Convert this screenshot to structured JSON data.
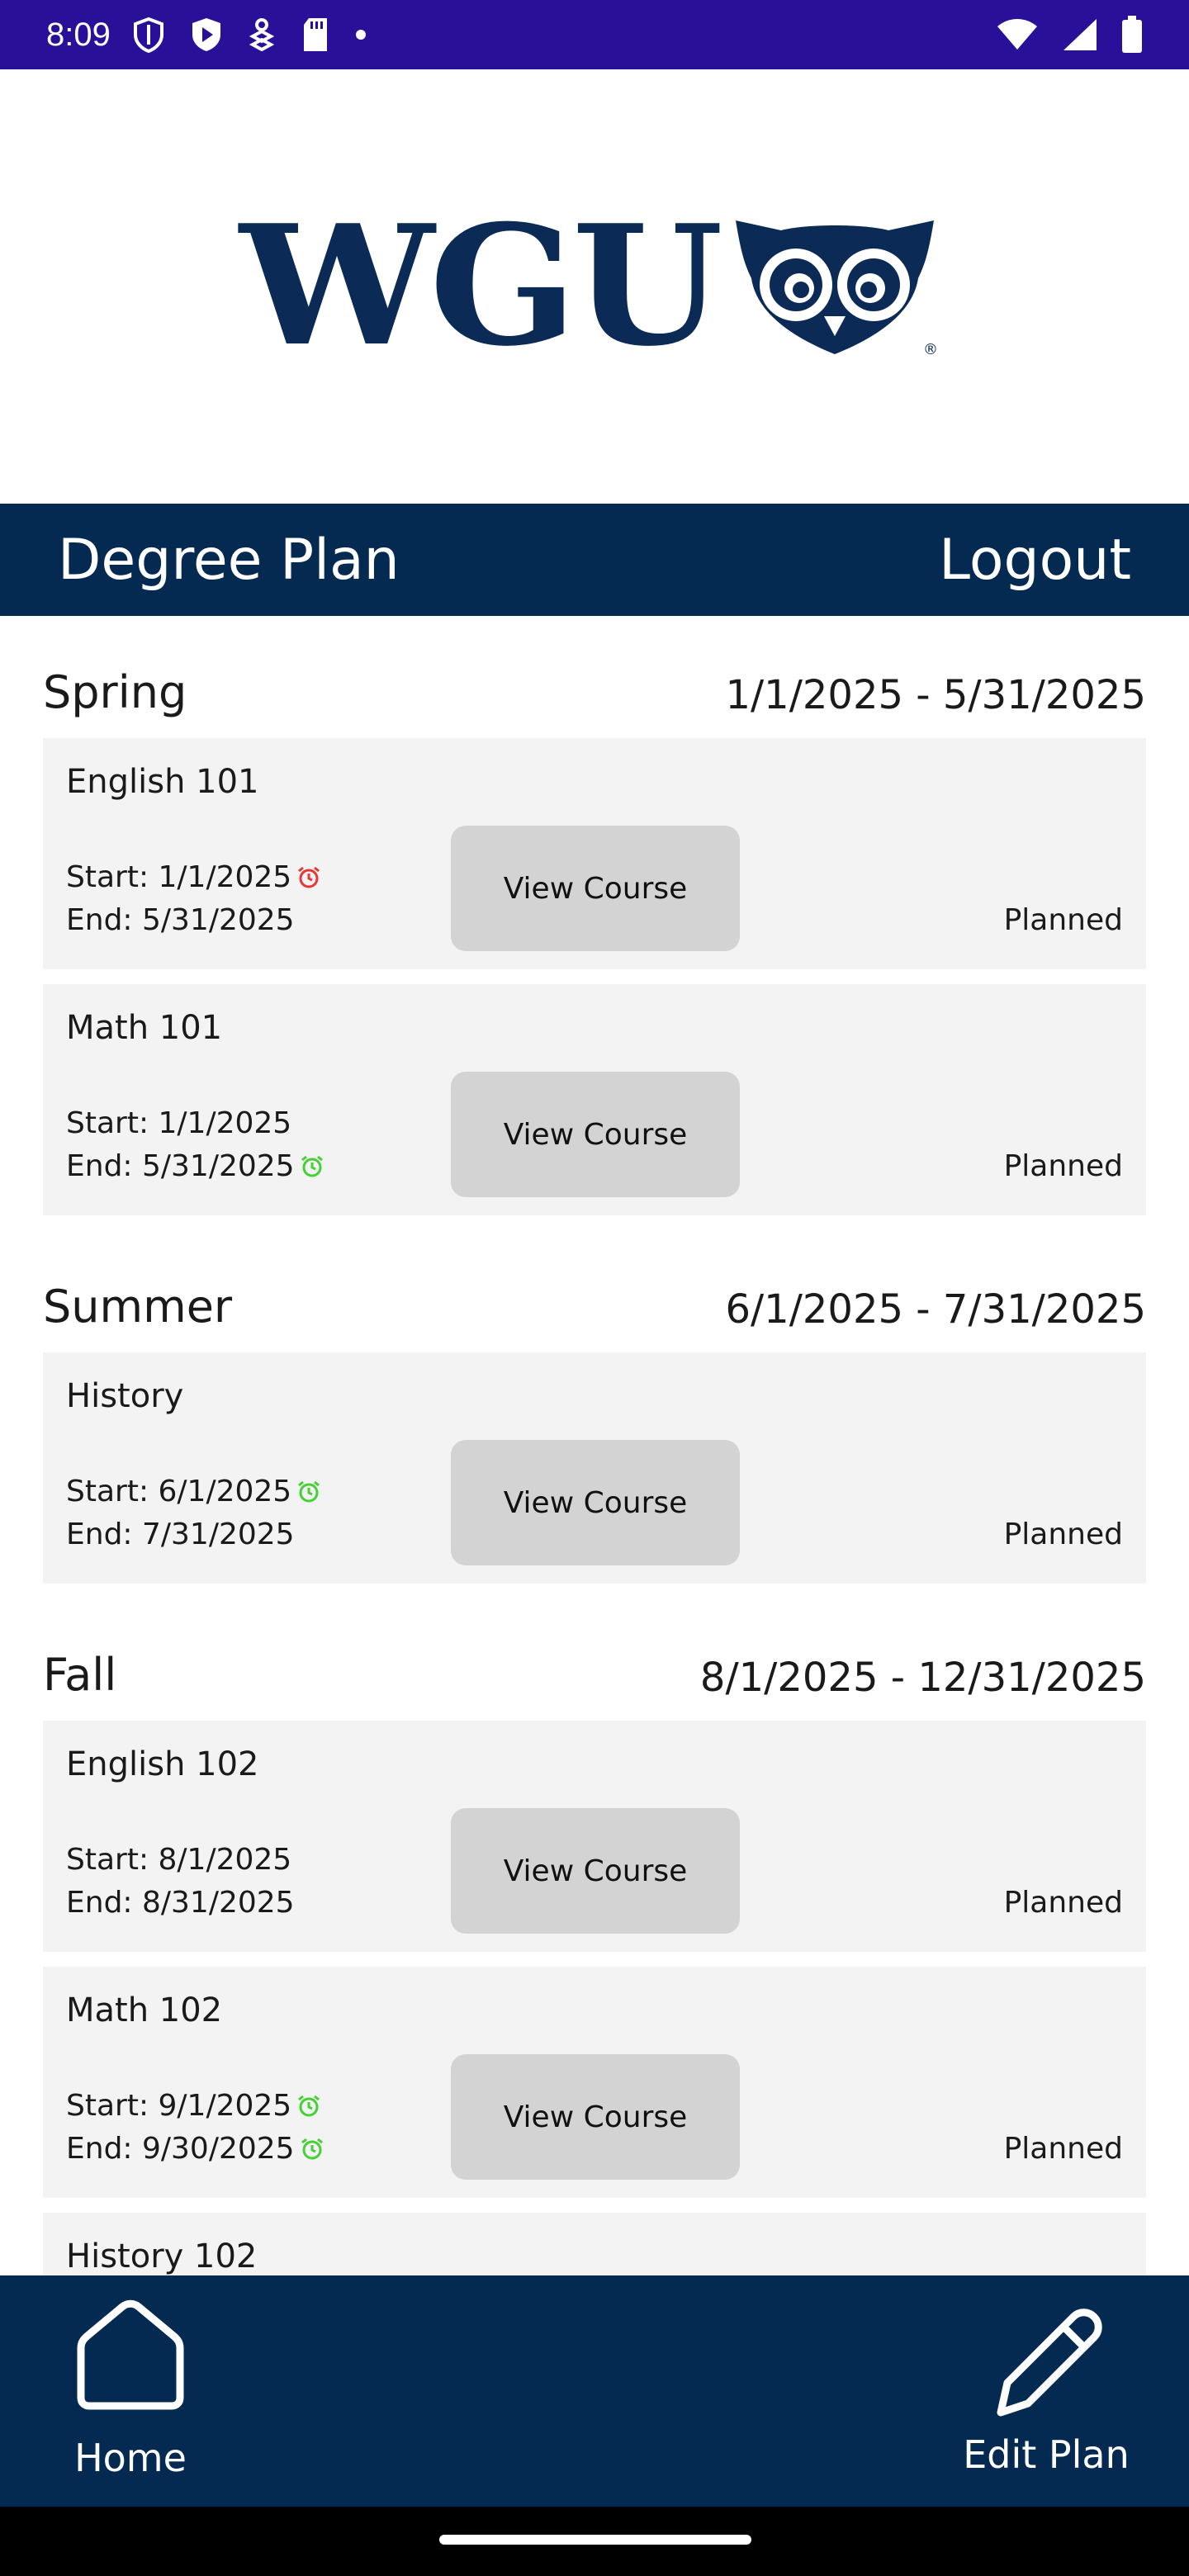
{
  "status_bar": {
    "time": "8:09",
    "icons": [
      "shield-icon",
      "play-protect-icon",
      "usb-debug-icon",
      "sd-card-icon",
      "dot-icon"
    ],
    "right_icons": [
      "wifi-icon",
      "signal-icon",
      "battery-icon"
    ]
  },
  "logo": {
    "text": "WGU",
    "mascot": "owl-logo-icon"
  },
  "header": {
    "title": "Degree Plan",
    "logout_label": "Logout"
  },
  "colors": {
    "header_bg": "#052a52",
    "status_bg": "#2a0f99",
    "card_bg": "#f3f3f3",
    "button_bg": "#d3d3d3",
    "alarm_red": "#e53935",
    "alarm_green": "#43d133"
  },
  "terms": [
    {
      "name": "Spring",
      "dates": "1/1/2025 - 5/31/2025",
      "courses": [
        {
          "name": "English 101",
          "start": "Start: 1/1/2025",
          "end": "End: 5/31/2025",
          "button": "View Course",
          "status": "Planned"
        },
        {
          "name": "Math 101",
          "start": "Start: 1/1/2025",
          "end": "End: 5/31/2025",
          "button": "View Course",
          "status": "Planned"
        }
      ]
    },
    {
      "name": "Summer",
      "dates": "6/1/2025 - 7/31/2025",
      "courses": [
        {
          "name": "History",
          "start": "Start: 6/1/2025",
          "end": "End: 7/31/2025",
          "button": "View Course",
          "status": "Planned"
        }
      ]
    },
    {
      "name": "Fall",
      "dates": "8/1/2025 - 12/31/2025",
      "courses": [
        {
          "name": "English 102",
          "start": "Start: 8/1/2025",
          "end": "End: 8/31/2025",
          "button": "View Course",
          "status": "Planned"
        },
        {
          "name": "Math 102",
          "start": "Start: 9/1/2025",
          "end": "End: 9/30/2025",
          "button": "View Course",
          "status": "Planned"
        },
        {
          "name": "History 102",
          "start": "",
          "end": "",
          "button": "",
          "status": ""
        }
      ]
    }
  ],
  "bottom_nav": {
    "home_label": "Home",
    "edit_label": "Edit Plan"
  }
}
